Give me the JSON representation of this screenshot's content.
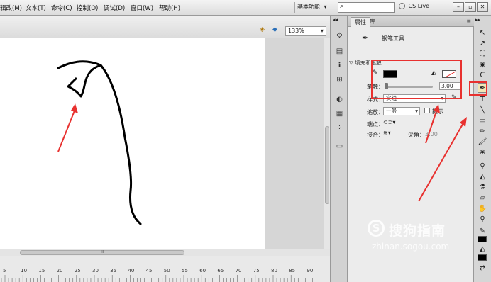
{
  "menu": {
    "items": [
      "辑改(M)",
      "文本(T)",
      "命令(C)",
      "控制(O)",
      "调试(D)",
      "窗口(W)",
      "帮助(H)"
    ]
  },
  "titlebar": {
    "workspace_label": "基本功能",
    "search_placeholder": "",
    "cs_live_label": "CS Live"
  },
  "stage": {
    "zoom_value": "133%",
    "scroll_grip": "III"
  },
  "timeline": {
    "ruler_labels": [
      "5",
      "10",
      "15",
      "20",
      "25",
      "30",
      "35",
      "40",
      "45",
      "50",
      "55",
      "60",
      "65",
      "70",
      "75",
      "80",
      "85",
      "90"
    ]
  },
  "properties": {
    "tab_properties": "属性",
    "tab_library": "库",
    "tool_name": "钢笔工具",
    "section_fill_stroke": "填充和笔触",
    "stroke_label": "笔触：",
    "stroke_value": "3.00",
    "style_label": "样式：",
    "style_value": "实线",
    "scale_label": "缩放：",
    "scale_value": "一般",
    "hint_label": "提示",
    "cap_label": "端点：",
    "join_label": "接合：",
    "miter_label": "尖角：",
    "miter_value": "3.00",
    "stroke_color": "#000000",
    "fill_color": "none"
  },
  "watermark": {
    "text_cn": "搜狗指南",
    "text_url": "zhinan.sogou.com"
  },
  "colors": {
    "annotation_red": "#e8312f"
  }
}
